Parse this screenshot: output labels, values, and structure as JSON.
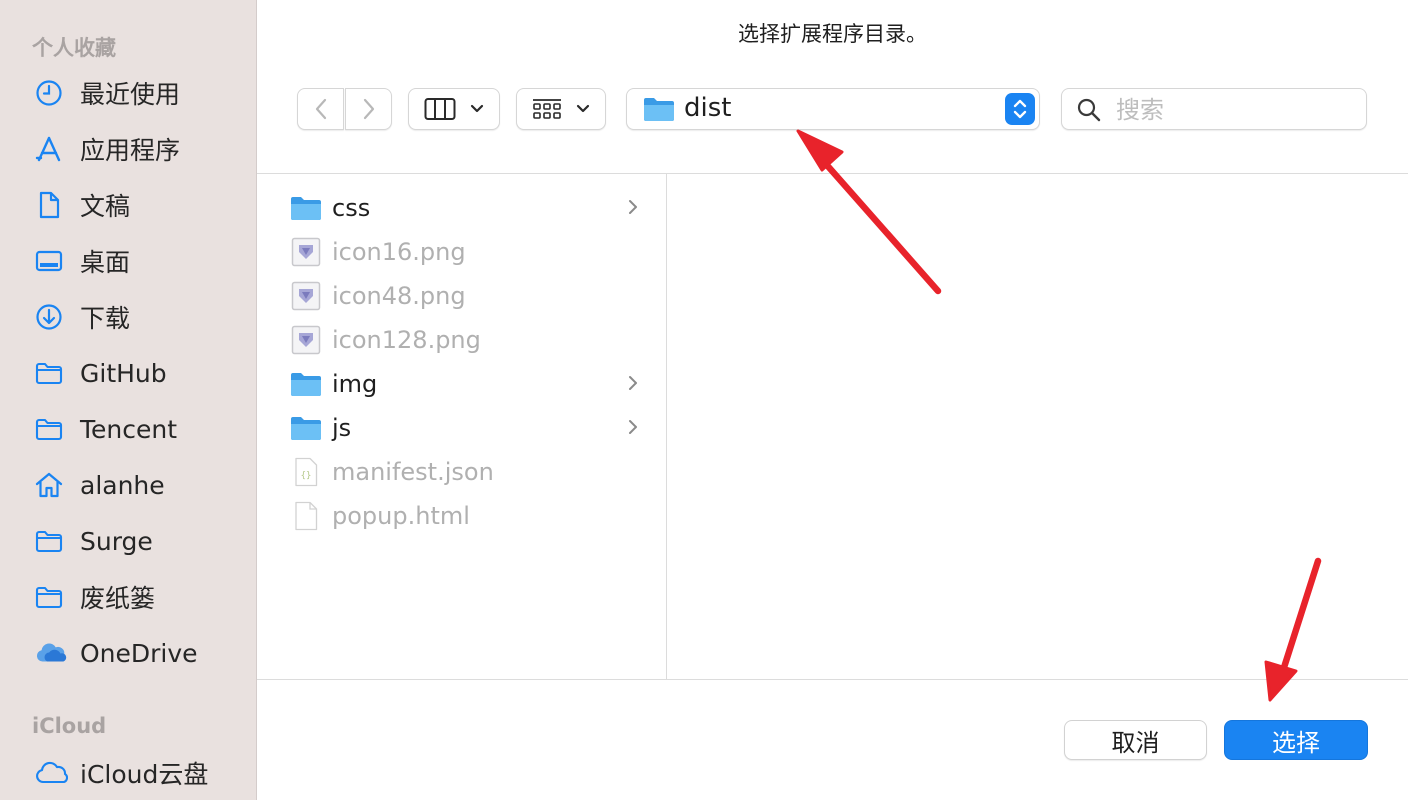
{
  "dialog": {
    "title": "选择扩展程序目录。"
  },
  "sidebar": {
    "section_personal": "个人收藏",
    "items": [
      {
        "label": "最近使用",
        "icon": "clock-icon"
      },
      {
        "label": "应用程序",
        "icon": "applications-icon"
      },
      {
        "label": "文稿",
        "icon": "document-icon"
      },
      {
        "label": "桌面",
        "icon": "desktop-icon"
      },
      {
        "label": "下载",
        "icon": "download-icon"
      },
      {
        "label": "GitHub",
        "icon": "folder-icon"
      },
      {
        "label": "Tencent",
        "icon": "folder-icon"
      },
      {
        "label": "alanhe",
        "icon": "home-icon"
      },
      {
        "label": "Surge",
        "icon": "folder-icon"
      },
      {
        "label": "废纸篓",
        "icon": "folder-icon"
      },
      {
        "label": "OneDrive",
        "icon": "cloud-icon"
      }
    ],
    "section_icloud": "iCloud",
    "icloud_items": [
      {
        "label": "iCloud云盘",
        "icon": "cloud-outline-icon"
      }
    ]
  },
  "toolbar": {
    "current_folder": "dist",
    "search_placeholder": "搜索"
  },
  "files": [
    {
      "name": "css",
      "type": "folder",
      "enabled": true
    },
    {
      "name": "icon16.png",
      "type": "image",
      "enabled": false
    },
    {
      "name": "icon48.png",
      "type": "image",
      "enabled": false
    },
    {
      "name": "icon128.png",
      "type": "image",
      "enabled": false
    },
    {
      "name": "img",
      "type": "folder",
      "enabled": true
    },
    {
      "name": "js",
      "type": "folder",
      "enabled": true
    },
    {
      "name": "manifest.json",
      "type": "json",
      "enabled": false
    },
    {
      "name": "popup.html",
      "type": "file",
      "enabled": false
    }
  ],
  "buttons": {
    "cancel": "取消",
    "choose": "选择"
  },
  "colors": {
    "accent": "#1a84f2",
    "annotation_arrow": "#e8232b",
    "sidebar_bg": "#e9e1df"
  }
}
